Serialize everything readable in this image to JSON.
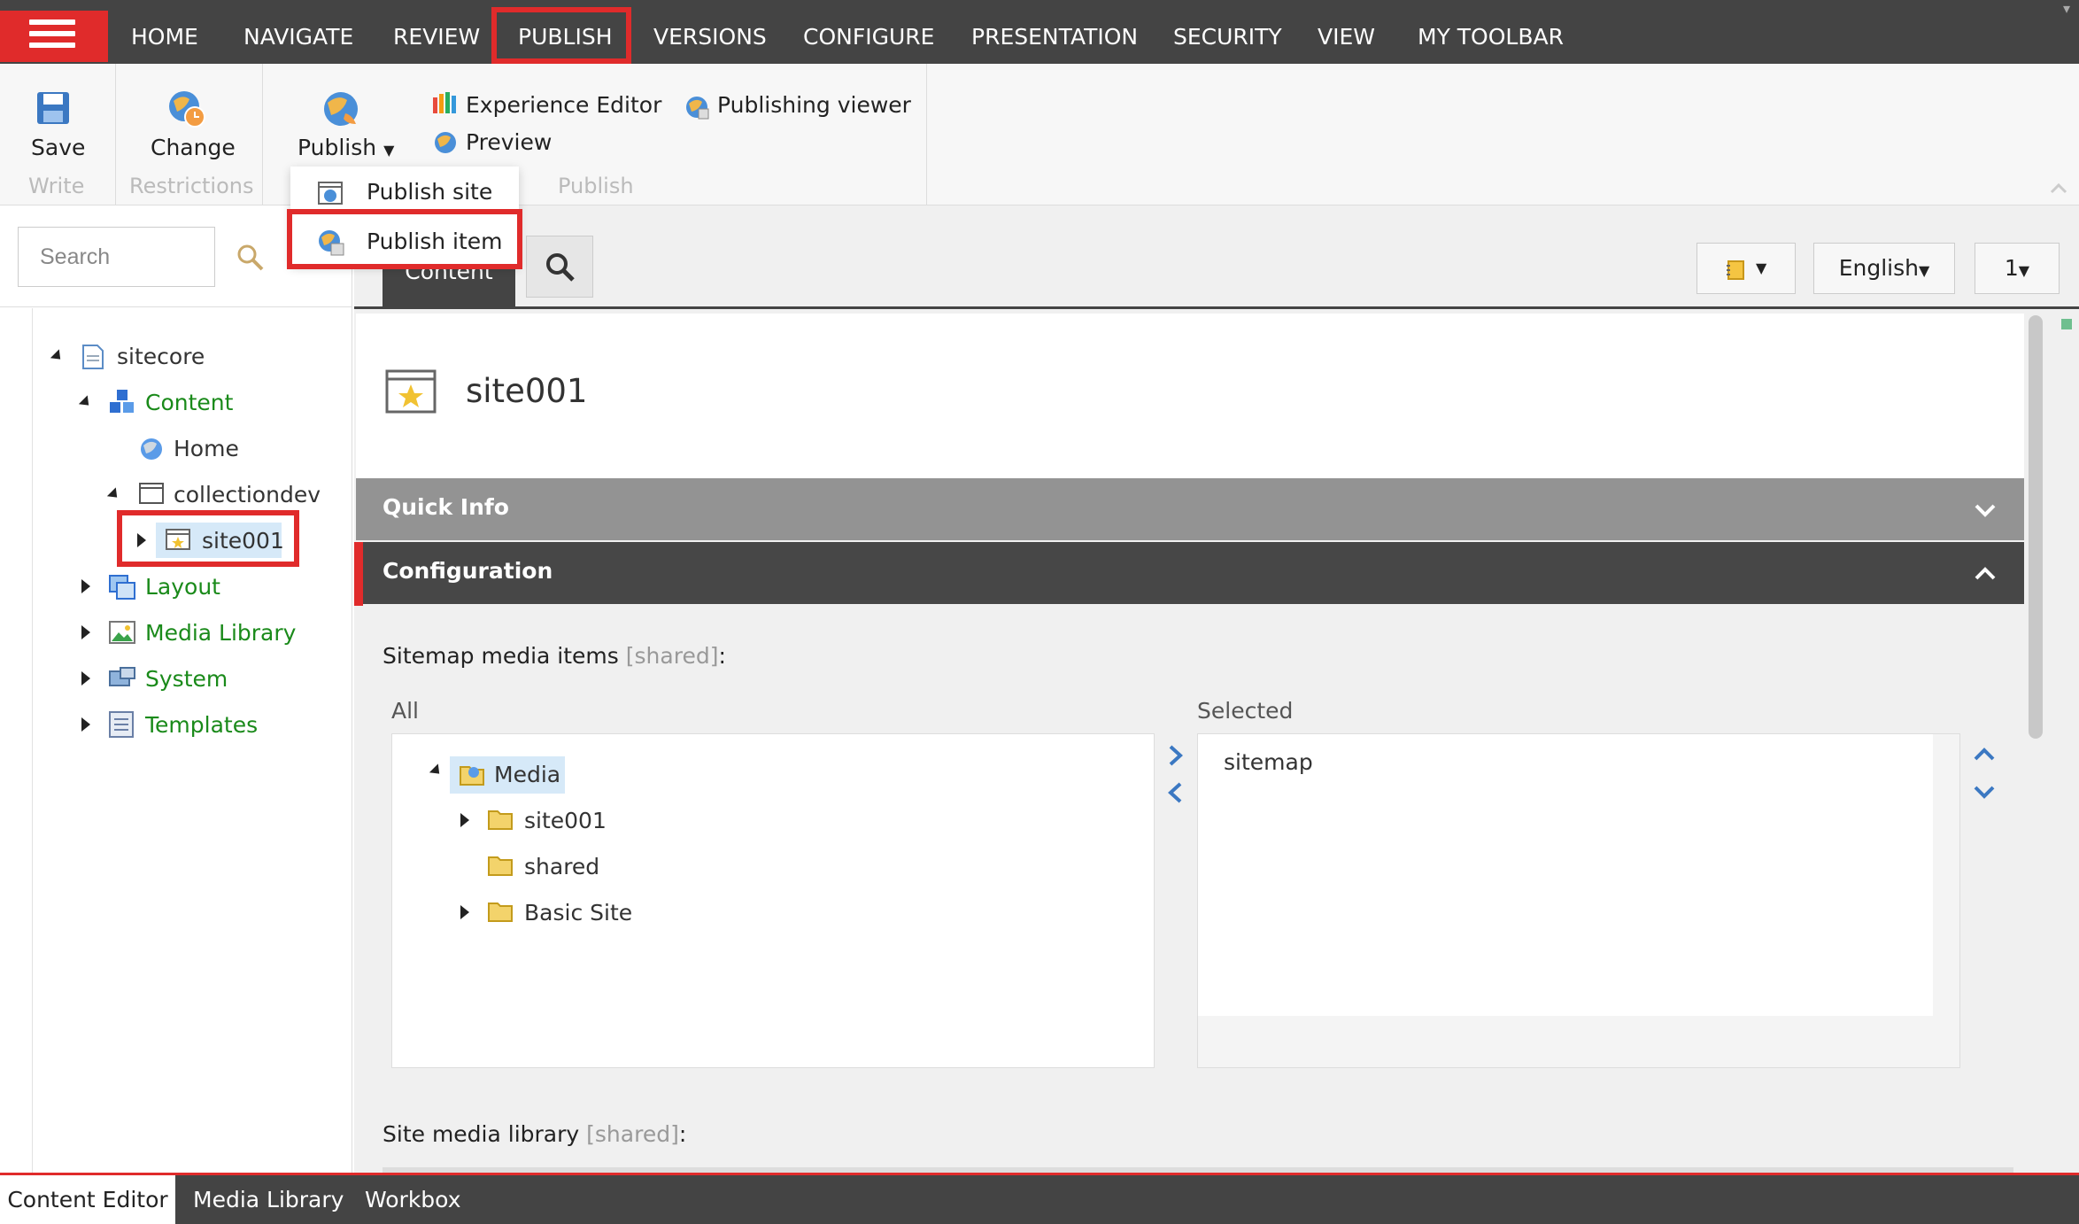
{
  "top_nav": {
    "tabs": [
      "HOME",
      "NAVIGATE",
      "REVIEW",
      "PUBLISH",
      "VERSIONS",
      "CONFIGURE",
      "PRESENTATION",
      "SECURITY",
      "VIEW",
      "MY TOOLBAR"
    ],
    "highlighted_tab": "PUBLISH"
  },
  "ribbon": {
    "save_label": "Save",
    "change_label": "Change",
    "publish_label": "Publish",
    "experience_editor_label": "Experience Editor",
    "preview_label": "Preview",
    "publishing_viewer_label": "Publishing viewer",
    "groups": {
      "write": "Write",
      "restrictions": "Restrictions",
      "publish": "Publish"
    }
  },
  "publish_dropdown": {
    "items": [
      "Publish site",
      "Publish item"
    ],
    "highlighted_item": "Publish item"
  },
  "search": {
    "placeholder": "Search"
  },
  "tree": {
    "nodes": [
      {
        "label": "sitecore",
        "color": "dark"
      },
      {
        "label": "Content",
        "color": "green"
      },
      {
        "label": "Home",
        "color": "dark"
      },
      {
        "label": "collectiondev",
        "color": "dark"
      },
      {
        "label": "site001",
        "color": "dark",
        "selected": true
      },
      {
        "label": "Layout",
        "color": "green"
      },
      {
        "label": "Media Library",
        "color": "green"
      },
      {
        "label": "System",
        "color": "green"
      },
      {
        "label": "Templates",
        "color": "green"
      }
    ]
  },
  "content": {
    "active_tab": "Content",
    "language": "English",
    "version": "1",
    "item_title": "site001",
    "sections": [
      "Quick Info",
      "Configuration"
    ],
    "field_sitemap_media": {
      "label": "Sitemap media items",
      "shared_tag": "[shared]",
      "colon": ":"
    },
    "all_label": "All",
    "selected_label": "Selected",
    "media_tree": [
      "Media",
      "site001",
      "shared",
      "Basic Site"
    ],
    "selected_items": [
      "sitemap"
    ],
    "field_site_media_library": {
      "label": "Site media library",
      "shared_tag": "[shared]",
      "colon": ":"
    }
  },
  "bottom_tabs": [
    "Content Editor",
    "Media Library",
    "Workbox"
  ],
  "colors": {
    "accent_red": "#e02b2b",
    "nav_bg": "#444444",
    "tree_green": "#1a8a1a",
    "section_gray": "#939393",
    "section_dark": "#474747"
  }
}
